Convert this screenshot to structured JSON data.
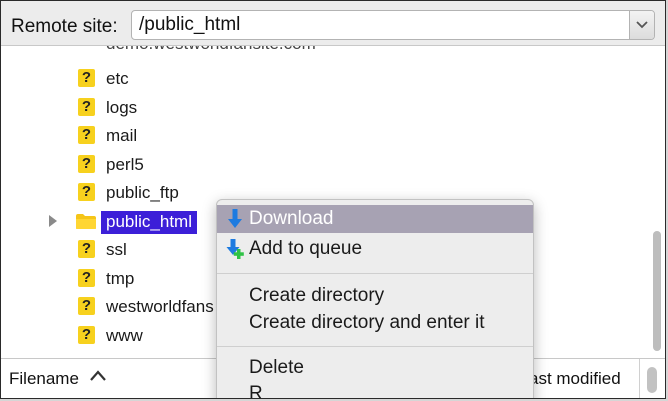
{
  "remote_site": {
    "label": "Remote site:",
    "path": "/public_html"
  },
  "tree": {
    "cut_item": "demo.westworldfansite.com",
    "items": [
      {
        "name": "etc",
        "icon": "unknown-question-icon"
      },
      {
        "name": "logs",
        "icon": "unknown-question-icon"
      },
      {
        "name": "mail",
        "icon": "unknown-question-icon"
      },
      {
        "name": "perl5",
        "icon": "unknown-question-icon"
      },
      {
        "name": "public_ftp",
        "icon": "unknown-question-icon"
      },
      {
        "name": "public_html",
        "icon": "folder-icon",
        "selected": true
      },
      {
        "name": "ssl",
        "icon": "unknown-question-icon"
      },
      {
        "name": "tmp",
        "icon": "unknown-question-icon"
      },
      {
        "name": "westworldfans",
        "icon": "unknown-question-icon"
      },
      {
        "name": "www",
        "icon": "unknown-question-icon"
      }
    ]
  },
  "list_header": {
    "filename": "Filename",
    "last_modified": "ast modified"
  },
  "context_menu": {
    "items": [
      {
        "label": "Download",
        "icon": "download-arrow-icon",
        "highlighted": true
      },
      {
        "label": "Add to queue",
        "icon": "add-to-queue-icon"
      },
      {
        "label": "Create directory"
      },
      {
        "label": "Create directory and enter it"
      },
      {
        "label": "Delete"
      },
      {
        "label": "R"
      }
    ]
  },
  "colors": {
    "selection": "#3c1fd8",
    "menu_highlight": "#a7a2b3",
    "question_icon": "#f7d11e",
    "download_arrow": "#1e7be0",
    "queue_plus": "#2fc246"
  }
}
